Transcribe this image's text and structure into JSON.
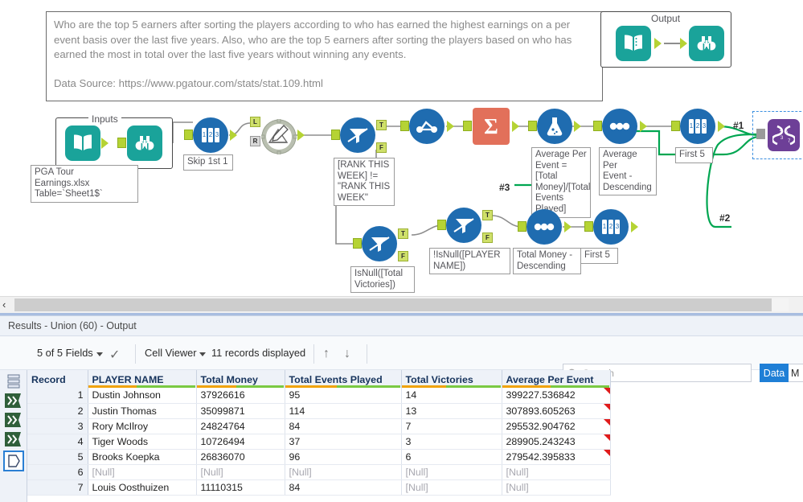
{
  "canvas": {
    "comment": {
      "body": "Who are the top 5 earners after sorting the players according to who has earned the highest earnings on a per event basis over the last five years. Also, who are the top 5 earners after sorting the players based on who has earned the most in total over the last five years without winning any events.",
      "source": "Data Source: https://www.pgatour.com/stats/stat.109.html"
    },
    "output_group_label": "Output",
    "inputs_group_label": "Inputs",
    "annotations": {
      "input_file": "PGA Tour Earnings.xlsx Table=`Sheet1$`",
      "input_file_line1": "PGA Tour",
      "input_file_line2": "Earnings.xlsx",
      "input_file_line3": "Table=`Sheet1$`",
      "sample_skip": "Skip 1st 1",
      "filter_rank": "[RANK THIS WEEK] != \"RANK THIS WEEK\"",
      "formula_avg": "Average Per Event = [Total Money]/[Total Events Played]",
      "sort_avg": "Average Per Event - Descending",
      "first5_top": "First 5",
      "filter_isnull": "IsNull([Total Victories])",
      "filter_notnull": "!IsNull([PLAYER NAME])",
      "sort_money": "Total Money - Descending",
      "first5_bottom": "First 5"
    },
    "connection_labels": {
      "one": "#1",
      "two": "#2",
      "three": "#3"
    },
    "anchor_true": "T",
    "anchor_false": "F",
    "colors": {
      "tool_blue": "#1f6cb0",
      "tool_summarize": "#e2705a",
      "tool_union": "#6d3f97",
      "teal": "#1aa39a",
      "anchor_green": "#b5d334",
      "wire_selected": "#00a651"
    }
  },
  "results": {
    "title": "Results - Union (60) - Output",
    "toolbar": {
      "fields": "5 of 5 Fields",
      "cell_viewer": "Cell Viewer",
      "records": "11 records displayed",
      "arrow_up": "↑",
      "arrow_down": "↓"
    },
    "search": {
      "placeholder": "Search",
      "value": ""
    },
    "buttons": {
      "data": "Data",
      "metadata": "M"
    },
    "table": {
      "columns": [
        "Record",
        "PLAYER NAME",
        "Total Money",
        "Total Events Played",
        "Total Victories",
        "Average Per Event"
      ],
      "header_underlines": [
        "none",
        "orange-green",
        "orange-green",
        "orange-green",
        "orange-green",
        "orange-green"
      ],
      "rows": [
        {
          "record": "1",
          "player": "Dustin Johnson",
          "money": "37926616",
          "events": "95",
          "victories": "14",
          "avg": "399227.536842",
          "flag": true
        },
        {
          "record": "2",
          "player": "Justin Thomas",
          "money": "35099871",
          "events": "114",
          "victories": "13",
          "avg": "307893.605263",
          "flag": true
        },
        {
          "record": "3",
          "player": "Rory McIlroy",
          "money": "24824764",
          "events": "84",
          "victories": "7",
          "avg": "295532.904762",
          "flag": true
        },
        {
          "record": "4",
          "player": "Tiger Woods",
          "money": "10726494",
          "events": "37",
          "victories": "3",
          "avg": "289905.243243",
          "flag": true
        },
        {
          "record": "5",
          "player": "Brooks Koepka",
          "money": "26836070",
          "events": "96",
          "victories": "6",
          "avg": "279542.395833",
          "flag": true
        },
        {
          "record": "6",
          "player": "[Null]",
          "money": "[Null]",
          "events": "[Null]",
          "victories": "[Null]",
          "avg": "[Null]",
          "flag": false
        },
        {
          "record": "7",
          "player": "Louis Oosthuizen",
          "money": "11110315",
          "events": "84",
          "victories": "[Null]",
          "avg": "[Null]",
          "flag": false
        }
      ]
    }
  }
}
